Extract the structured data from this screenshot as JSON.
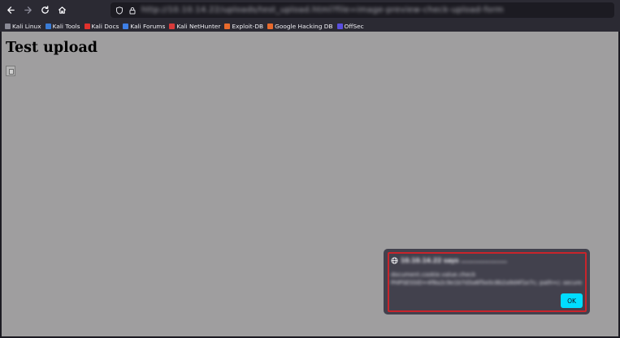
{
  "browser": {
    "toolbar": {
      "back_icon": "arrow-left-icon",
      "forward_icon": "arrow-right-icon",
      "reload_icon": "reload-icon",
      "home_icon": "home-icon",
      "url": "http://10.10.14.22/uploads/test_upload.html?file=image-preview-check-upload-form"
    },
    "bookmarks": [
      {
        "label": "Kali Linux",
        "color": "#8a8a96"
      },
      {
        "label": "Kali Tools",
        "color": "#3a7bd5"
      },
      {
        "label": "Kali Docs",
        "color": "#e0312c"
      },
      {
        "label": "Kali Forums",
        "color": "#3e7fe6"
      },
      {
        "label": "Kali NetHunter",
        "color": "#d83a3a"
      },
      {
        "label": "Exploit-DB",
        "color": "#e86a2c"
      },
      {
        "label": "Google Hacking DB",
        "color": "#e86a2c"
      },
      {
        "label": "OffSec",
        "color": "#5a4fe0"
      }
    ]
  },
  "page": {
    "title": "Test upload",
    "background": "#9f9e9f"
  },
  "dialog": {
    "origin": "10.10.14.22 says ....................",
    "line1": "document.cookie.value.check",
    "line2": "PHPSESSID=4f8a2c9e1b7d3a6f5e0c8b2a9d4f1e7c; path=/; secure",
    "ok_label": "OK",
    "highlight_color": "#c9242b",
    "accent_color": "#00ddff"
  }
}
